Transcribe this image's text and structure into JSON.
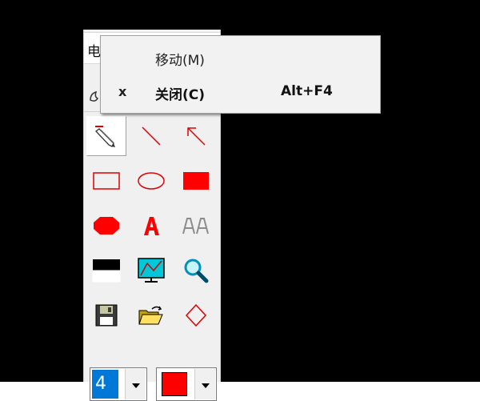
{
  "tool_window": {
    "title_fragment": "电",
    "line_width": "4",
    "current_color": "#ff0000",
    "tools": [
      {
        "name": "pencil",
        "icon": "pencil-icon",
        "selected": true
      },
      {
        "name": "line",
        "icon": "line-icon"
      },
      {
        "name": "arrow",
        "icon": "arrow-icon"
      },
      {
        "name": "rectangle",
        "icon": "rectangle-outline-icon"
      },
      {
        "name": "ellipse",
        "icon": "ellipse-outline-icon"
      },
      {
        "name": "filled-rectangle",
        "icon": "rectangle-filled-icon"
      },
      {
        "name": "filled-ellipse",
        "icon": "ellipse-filled-icon"
      },
      {
        "name": "text",
        "icon": "text-red-a-icon"
      },
      {
        "name": "text-style",
        "icon": "text-gray-aa-icon"
      },
      {
        "name": "black-white",
        "icon": "black-white-icon"
      },
      {
        "name": "screen",
        "icon": "screen-icon"
      },
      {
        "name": "zoom",
        "icon": "magnifier-icon"
      },
      {
        "name": "save",
        "icon": "floppy-disk-icon"
      },
      {
        "name": "open",
        "icon": "open-folder-icon"
      },
      {
        "name": "diamond",
        "icon": "diamond-outline-icon"
      }
    ]
  },
  "context_menu": {
    "items": [
      {
        "label": "移动(M)",
        "icon": "",
        "shortcut": ""
      },
      {
        "label": "关闭(C)",
        "icon": "x",
        "shortcut": "Alt+F4"
      }
    ]
  },
  "colors": {
    "desktop": "#000000",
    "accent_red": "#ff0000",
    "selection_blue": "#0078d7"
  }
}
